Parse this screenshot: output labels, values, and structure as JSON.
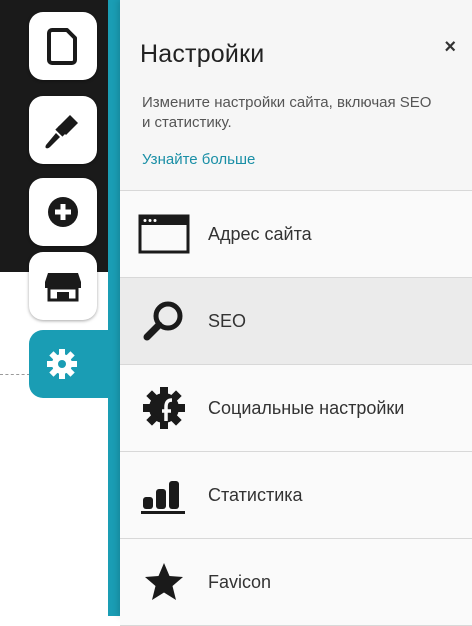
{
  "rail": {
    "items": [
      {
        "name": "pages",
        "icon": "page-icon"
      },
      {
        "name": "design",
        "icon": "brush-icon"
      },
      {
        "name": "add",
        "icon": "plus-icon"
      },
      {
        "name": "store",
        "icon": "store-icon"
      },
      {
        "name": "settings",
        "icon": "gear-icon",
        "active": true
      }
    ],
    "active_color": "#1a9db4"
  },
  "panel": {
    "title": "Настройки",
    "close_label": "×",
    "description": "Измените настройки сайта, включая SEO и статистику.",
    "learn_more": "Узнайте больше",
    "items": [
      {
        "label": "Адрес сайта",
        "icon": "browser-window-icon"
      },
      {
        "label": "SEO",
        "icon": "magnifier-icon",
        "selected": true
      },
      {
        "label": "Социальные настройки",
        "icon": "social-gear-icon"
      },
      {
        "label": "Статистика",
        "icon": "stats-icon"
      },
      {
        "label": "Favicon",
        "icon": "star-icon"
      }
    ]
  },
  "colors": {
    "accent": "#1a9db4",
    "link": "#1a8fa6",
    "dark": "#1a1a1a"
  }
}
